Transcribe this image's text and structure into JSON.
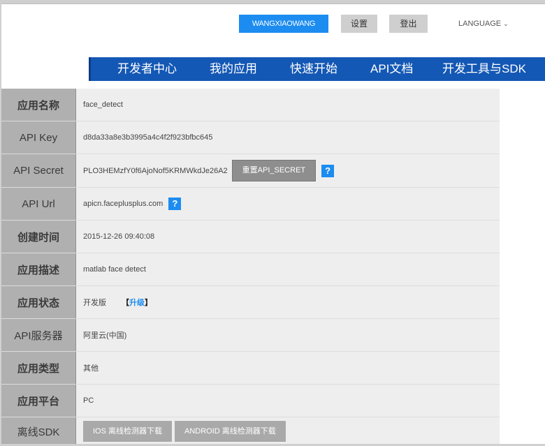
{
  "header": {
    "username": "WANGXIAOWANG",
    "settings_label": "设置",
    "logout_label": "登出",
    "language_label": "LANGUAGE",
    "language_chevron": "⌄"
  },
  "nav": {
    "items": [
      "开发者中心",
      "我的应用",
      "快速开始",
      "API文档",
      "开发工具与SDK"
    ]
  },
  "app_info": {
    "rows": [
      {
        "label": "应用名称",
        "value": "face_detect"
      },
      {
        "label": "API Key",
        "value": "d8da33a8e3b3995a4c4f2f923bfbc645"
      },
      {
        "label": "API Secret",
        "value": "PLO3HEMzfY0f6AjoNof5KRMWkdJe26A2",
        "button": "重置API_SECRET",
        "help": "?"
      },
      {
        "label": "API Url",
        "value": "apicn.faceplusplus.com",
        "help": "?"
      },
      {
        "label": "创建时间",
        "value": "2015-12-26 09:40:08"
      },
      {
        "label": "应用描述",
        "value": "matlab face detect"
      },
      {
        "label": "应用状态",
        "value": "开发版",
        "upgrade_open": "【",
        "upgrade_link": "升级",
        "upgrade_close": "】"
      },
      {
        "label": "API服务器",
        "value": "阿里云(中国)"
      },
      {
        "label": "应用类型",
        "value": "其他"
      },
      {
        "label": "应用平台",
        "value": "PC"
      },
      {
        "label": "离线SDK",
        "buttons": [
          "IOS 离线检测器下载",
          "ANDROID 离线检测器下载"
        ]
      }
    ]
  },
  "colors": {
    "accent_blue": "#1c8cf0",
    "nav_blue": "#1458b5",
    "label_gray": "#b0b0b0",
    "value_gray": "#eeeeee"
  }
}
